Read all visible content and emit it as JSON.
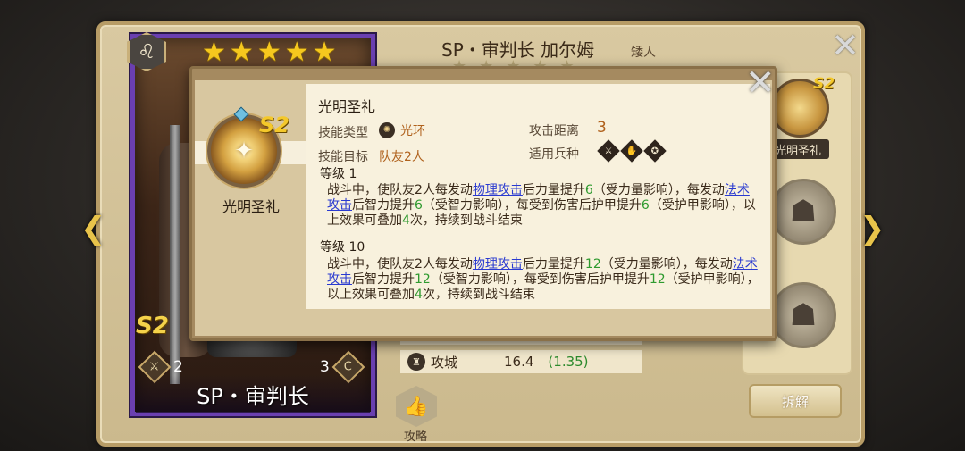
{
  "hero": {
    "name_header": "SP・审判长 加尔姆",
    "race": "矮人",
    "card_name": "SP・审判长",
    "stars": [
      "★",
      "★",
      "★",
      "★",
      "★"
    ],
    "skill_tier": "S2",
    "left_stat": "2",
    "right_stat": "3",
    "right_stat_letter": "C"
  },
  "right_panel": {
    "skill_tier": "S2",
    "skill_label": "光明圣礼",
    "disband_label": "拆解"
  },
  "stats": {
    "siege_label": "攻城",
    "siege_value": "16.4",
    "siege_bonus": "(1.35)"
  },
  "guide_label": "攻略",
  "popup": {
    "skill_name": "光明圣礼",
    "skill_tier": "S2",
    "skill_caption": "光明圣礼",
    "type_label": "技能类型",
    "type_value": "光环",
    "target_label": "技能目标",
    "target_value": "队友2人",
    "range_label": "攻击距离",
    "range_value": "3",
    "troop_label": "适用兵种",
    "level1_label": "等级 1",
    "level1_desc": {
      "a": "战斗中，使队友2人每发动",
      "link1": "物理攻击",
      "b": "后力量提升",
      "n1": "6",
      "c": "（受力量影响），每发动",
      "link2": "法术攻击",
      "d": "后智力提升",
      "n2": "6",
      "e": "（受智力影响），每受到伤害后护甲提升",
      "n3": "6",
      "f": "（受护甲影响），以上效果可叠加",
      "n4": "4",
      "g": "次，持续到战斗结束"
    },
    "level10_label": "等级 10",
    "level10_desc": {
      "a": "战斗中，使队友2人每发动",
      "link1": "物理攻击",
      "b": "后力量提升",
      "n1": "12",
      "c": "（受力量影响），每发动",
      "link2": "法术攻击",
      "d": "后智力提升",
      "n2": "12",
      "e": "（受智力影响），每受到伤害后护甲提升",
      "n3": "12",
      "f": "（受护甲影响），以上效果可叠加",
      "n4": "4",
      "g": "次，持续到战斗结束"
    }
  },
  "colors": {
    "card_border": "#6a3fb0",
    "star": "#f6c81e",
    "accent_number": "#2e9a2e",
    "link": "#2a3ad0",
    "value_orange": "#b0621d"
  }
}
